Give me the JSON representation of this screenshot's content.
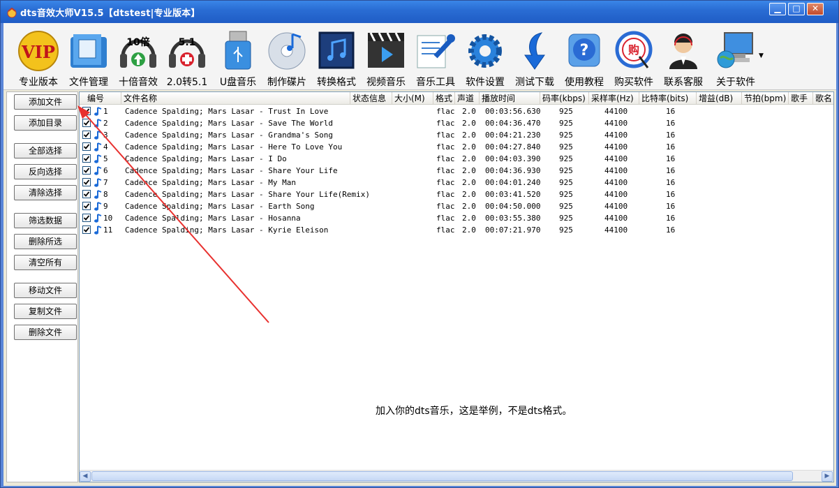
{
  "window": {
    "title": "dts音效大师V15.5【dtstest|专业版本】",
    "min_glyph": "▁",
    "max_glyph": "□",
    "close_glyph": "✕"
  },
  "toolbar": [
    {
      "label": "专业版本",
      "icon": "vip-icon",
      "badge": "VIP"
    },
    {
      "label": "文件管理",
      "icon": "folder-icon",
      "badge": ""
    },
    {
      "label": "十倍音效",
      "icon": "headphones-10x-icon",
      "badge": "10倍"
    },
    {
      "label": "2.0转5.1",
      "icon": "headphones-51-icon",
      "badge": "5.1"
    },
    {
      "label": "U盘音乐",
      "icon": "usb-drive-icon",
      "badge": ""
    },
    {
      "label": "制作碟片",
      "icon": "disc-icon",
      "badge": ""
    },
    {
      "label": "转换格式",
      "icon": "music-note-icon",
      "badge": ""
    },
    {
      "label": "视频音乐",
      "icon": "clapperboard-icon",
      "badge": ""
    },
    {
      "label": "音乐工具",
      "icon": "tools-icon",
      "badge": ""
    },
    {
      "label": "软件设置",
      "icon": "gear-icon",
      "badge": ""
    },
    {
      "label": "测试下载",
      "icon": "download-arrow-icon",
      "badge": ""
    },
    {
      "label": "使用教程",
      "icon": "help-icon",
      "badge": ""
    },
    {
      "label": "购买软件",
      "icon": "buy-icon",
      "badge": "购"
    },
    {
      "label": "联系客服",
      "icon": "support-agent-icon",
      "badge": ""
    },
    {
      "label": "关于软件",
      "icon": "computer-globe-icon",
      "badge": ""
    }
  ],
  "sidebar": {
    "buttons": [
      "添加文件",
      "添加目录",
      "全部选择",
      "反向选择",
      "清除选择",
      "筛选数据",
      "删除所选",
      "清空所有",
      "移动文件",
      "复制文件",
      "删除文件"
    ]
  },
  "table": {
    "columns": [
      "编号",
      "文件名称",
      "状态信息",
      "大小(M)",
      "格式",
      "声道",
      "播放时间",
      "码率(kbps)",
      "采样率(Hz)",
      "比特率(bits)",
      "增益(dB)",
      "节拍(bpm)",
      "歌手",
      "歌名"
    ],
    "rows": [
      {
        "no": "1",
        "name": "Cadence Spalding; Mars Lasar - Trust In Love",
        "format": "flac",
        "channels": "2.0",
        "duration": "00:03:56.630",
        "bitrate": "925",
        "samplerate": "44100",
        "bits": "16"
      },
      {
        "no": "2",
        "name": "Cadence Spalding; Mars Lasar - Save The World",
        "format": "flac",
        "channels": "2.0",
        "duration": "00:04:36.470",
        "bitrate": "925",
        "samplerate": "44100",
        "bits": "16"
      },
      {
        "no": "3",
        "name": "Cadence Spalding; Mars Lasar - Grandma's Song",
        "format": "flac",
        "channels": "2.0",
        "duration": "00:04:21.230",
        "bitrate": "925",
        "samplerate": "44100",
        "bits": "16"
      },
      {
        "no": "4",
        "name": "Cadence Spalding; Mars Lasar - Here To Love You",
        "format": "flac",
        "channels": "2.0",
        "duration": "00:04:27.840",
        "bitrate": "925",
        "samplerate": "44100",
        "bits": "16"
      },
      {
        "no": "5",
        "name": "Cadence Spalding; Mars Lasar - I Do",
        "format": "flac",
        "channels": "2.0",
        "duration": "00:04:03.390",
        "bitrate": "925",
        "samplerate": "44100",
        "bits": "16"
      },
      {
        "no": "6",
        "name": "Cadence Spalding; Mars Lasar - Share Your Life",
        "format": "flac",
        "channels": "2.0",
        "duration": "00:04:36.930",
        "bitrate": "925",
        "samplerate": "44100",
        "bits": "16"
      },
      {
        "no": "7",
        "name": "Cadence Spalding; Mars Lasar - My Man",
        "format": "flac",
        "channels": "2.0",
        "duration": "00:04:01.240",
        "bitrate": "925",
        "samplerate": "44100",
        "bits": "16"
      },
      {
        "no": "8",
        "name": "Cadence Spalding; Mars Lasar - Share Your Life(Remix)",
        "format": "flac",
        "channels": "2.0",
        "duration": "00:03:41.520",
        "bitrate": "925",
        "samplerate": "44100",
        "bits": "16"
      },
      {
        "no": "9",
        "name": "Cadence Spalding; Mars Lasar - Earth Song",
        "format": "flac",
        "channels": "2.0",
        "duration": "00:04:50.000",
        "bitrate": "925",
        "samplerate": "44100",
        "bits": "16"
      },
      {
        "no": "10",
        "name": "Cadence Spalding; Mars Lasar - Hosanna",
        "format": "flac",
        "channels": "2.0",
        "duration": "00:03:55.380",
        "bitrate": "925",
        "samplerate": "44100",
        "bits": "16"
      },
      {
        "no": "11",
        "name": "Cadence Spalding; Mars Lasar - Kyrie Eleison",
        "format": "flac",
        "channels": "2.0",
        "duration": "00:07:21.970",
        "bitrate": "925",
        "samplerate": "44100",
        "bits": "16"
      }
    ]
  },
  "annotation": {
    "text": "加入你的dts音乐，这是举例，不是dts格式。",
    "arrow_color": "#e8312f"
  },
  "colors": {
    "titlebar": "#2a6dd4",
    "accent_blue": "#1f5cc5",
    "note_blue": "#1a6ad8"
  }
}
